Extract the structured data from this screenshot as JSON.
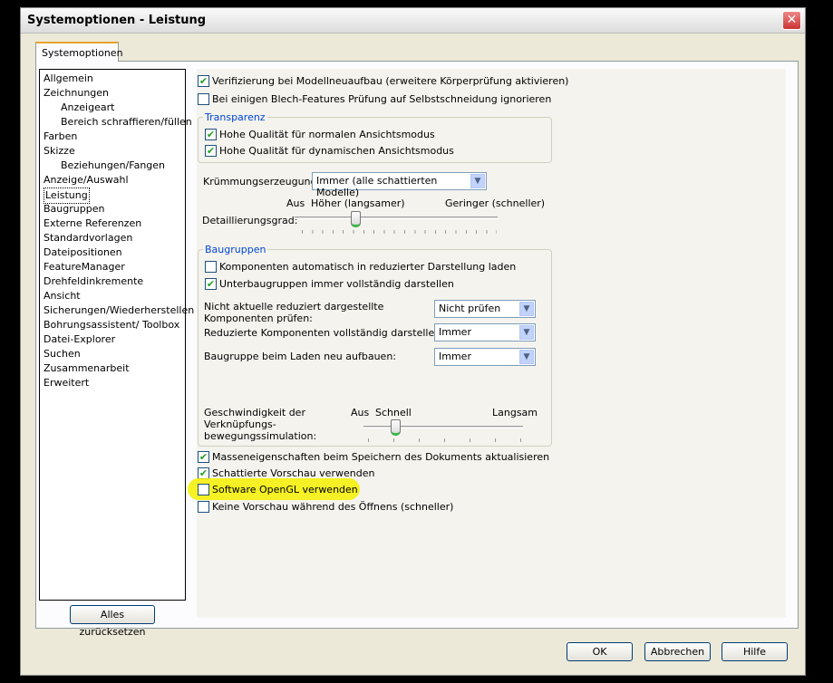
{
  "window": {
    "title": "Systemoptionen - Leistung",
    "close": "✕"
  },
  "tab": "Systemoptionen",
  "tree": [
    "Allgemein",
    "Zeichnungen",
    "Anzeigeart",
    "Bereich schraffieren/füllen",
    "Farben",
    "Skizze",
    "Beziehungen/Fangen",
    "Anzeige/Auswahl",
    "Leistung",
    "Baugruppen",
    "Externe Referenzen",
    "Standardvorlagen",
    "Dateipositionen",
    "FeatureManager",
    "Drehfeldinkremente",
    "Ansicht",
    "Sicherungen/Wiederherstellen",
    "Bohrungsassistent/ Toolbox",
    "Datei-Explorer",
    "Suchen",
    "Zusammenarbeit",
    "Erweitert"
  ],
  "reset": "Alles zurücksetzen",
  "opts": {
    "verify": {
      "label": "Verifizierung bei Modellneuaufbau (erweitere Körperprüfung aktivieren)",
      "checked": true
    },
    "blech": {
      "label": "Bei einigen Blech-Features Prüfung auf Selbstschneidung ignorieren",
      "checked": false
    },
    "transparenz": "Transparenz",
    "hq_normal": {
      "label": "Hohe Qualität für normalen Ansichtsmodus",
      "checked": true
    },
    "hq_dyn": {
      "label": "Hohe Qualität für dynamischen Ansichtsmodus",
      "checked": true
    },
    "kruemmung_label": "Krümmungserzeugung:",
    "kruemmung_value": "Immer (alle schattierten Modelle)",
    "detail": {
      "aus": "Aus",
      "hoch": "Höher (langsamer)",
      "gering": "Geringer (schneller)",
      "label": "Detaillierungsgrad:",
      "value": 0.3
    },
    "baugruppen": "Baugruppen",
    "komp_auto": {
      "label": "Komponenten automatisch in reduzierter Darstellung laden",
      "checked": false
    },
    "unterbg": {
      "label": "Unterbaugruppen immer vollständig darstellen",
      "checked": true
    },
    "nicht_akt_label": "Nicht aktuelle reduziert dargestellte Komponenten prüfen:",
    "nicht_akt_value": "Nicht prüfen",
    "reduz_label": "Reduzierte Komponenten vollständig darstellen:",
    "reduz_value": "Immer",
    "neu_label": "Baugruppe beim Laden neu aufbauen:",
    "neu_value": "Immer",
    "speed": {
      "label": "Geschwindigkeit der Verknüpfungs-bewegungssimulation:",
      "aus": "Aus",
      "schnell": "Schnell",
      "langsam": "Langsam",
      "value": 0.2
    },
    "masse": {
      "label": "Masseneigenschaften beim Speichern des Dokuments aktualisieren",
      "checked": true
    },
    "schatt": {
      "label": "Schattierte Vorschau verwenden",
      "checked": true
    },
    "opengl": {
      "label": "Software OpenGL verwenden",
      "checked": false
    },
    "keine": {
      "label": "Keine Vorschau während des Öffnens (schneller)",
      "checked": false
    }
  },
  "buttons": {
    "ok": "OK",
    "cancel": "Abbrechen",
    "help": "Hilfe"
  }
}
